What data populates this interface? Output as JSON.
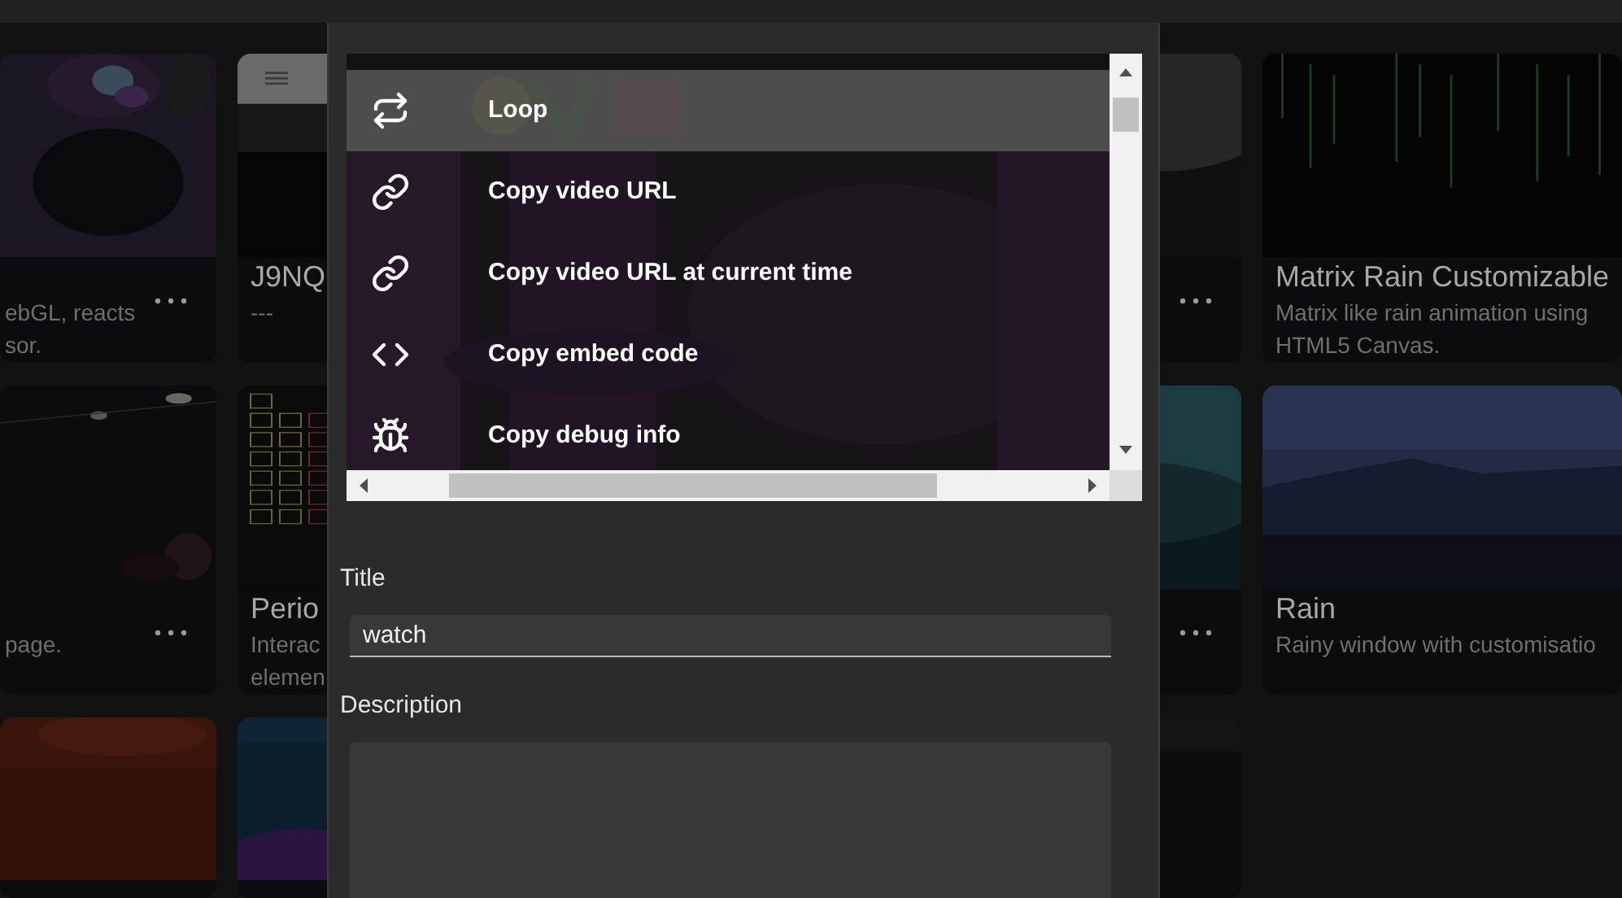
{
  "card_columns": [
    {
      "cards": [
        {
          "kind": "picture",
          "description": [
            "ebGL, reacts",
            "sor."
          ],
          "more": true
        },
        {
          "kind": "picture",
          "description": [
            "page."
          ],
          "more": true
        },
        {
          "kind": "picture"
        }
      ]
    },
    {
      "cards": [
        {
          "kind": "picture",
          "title": "J9NQ",
          "description": [
            "---"
          ]
        },
        {
          "kind": "picture",
          "title": "Perio",
          "description": [
            "Interac",
            "elemen"
          ]
        },
        {
          "kind": "picture"
        }
      ]
    },
    {
      "cards": [
        {
          "kind": "picture",
          "more": true
        },
        {
          "kind": "picture",
          "more": true
        },
        {
          "kind": "picture"
        }
      ]
    },
    {
      "cards": [
        {
          "kind": "picture",
          "title": "Matrix Rain Customizable",
          "description": [
            "Matrix like rain animation using",
            "HTML5 Canvas."
          ],
          "more": false
        },
        {
          "kind": "picture",
          "title": "Rain",
          "description": [
            "Rainy window with customisatio"
          ],
          "more": false
        }
      ]
    }
  ],
  "dialog": {
    "preview": {
      "menu": [
        {
          "kind": "loop",
          "label": "Loop",
          "selected": true
        },
        {
          "kind": "link",
          "label": "Copy video URL",
          "selected": false
        },
        {
          "kind": "link",
          "label": "Copy video URL at current time",
          "selected": false
        },
        {
          "kind": "code",
          "label": "Copy embed code",
          "selected": false
        },
        {
          "kind": "bug",
          "label": "Copy debug info",
          "selected": false
        }
      ]
    },
    "fields": [
      {
        "kind": "input",
        "label": "Title",
        "value": "watch"
      },
      {
        "kind": "textarea",
        "label": "Description"
      }
    ]
  }
}
